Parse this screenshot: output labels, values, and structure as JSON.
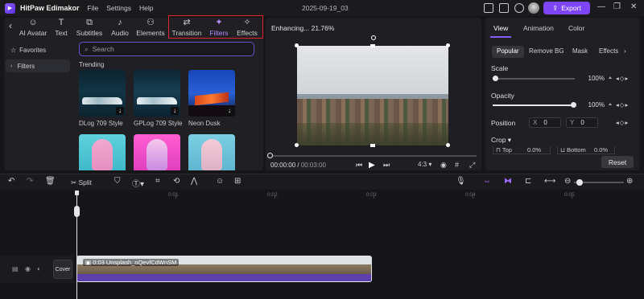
{
  "titlebar": {
    "app_name": "HitPaw Edimakor",
    "menus": [
      "File",
      "Settings",
      "Help"
    ],
    "doc_title": "2025-09-19_03",
    "export_label": "Export"
  },
  "toolbar": {
    "tools": [
      {
        "label": "AI Avatar",
        "icon": "avatar-icon"
      },
      {
        "label": "Text",
        "icon": "text-icon"
      },
      {
        "label": "Subtitles",
        "icon": "subtitles-icon"
      },
      {
        "label": "Audio",
        "icon": "music-icon"
      },
      {
        "label": "Elements",
        "icon": "elements-icon"
      },
      {
        "label": "Transition",
        "icon": "transition-icon"
      },
      {
        "label": "Filters",
        "icon": "sparkle-icon"
      },
      {
        "label": "Effects",
        "icon": "effects-icon"
      }
    ],
    "active_tool": "Filters"
  },
  "sidebar": {
    "items": [
      {
        "label": "Favorites"
      },
      {
        "label": "Filters"
      }
    ]
  },
  "search": {
    "placeholder": "Search"
  },
  "filters": {
    "section": "Trending",
    "row1": [
      {
        "label": "DLog 709 Style"
      },
      {
        "label": "GPLog 709 Style"
      },
      {
        "label": "Neon Dusk"
      }
    ]
  },
  "preview": {
    "status": "Enhancing... 21.76%",
    "current_time": "00:00:00",
    "total_time": "00:03:00",
    "aspect": "4:3"
  },
  "properties": {
    "tabs": [
      "View",
      "Animation",
      "Color"
    ],
    "active_tab": "View",
    "subtabs": [
      "Popular",
      "Remove BG",
      "Mask",
      "Effects"
    ],
    "active_subtab": "Popular",
    "scale": {
      "label": "Scale",
      "value": "100%",
      "level": 0.03
    },
    "opacity": {
      "label": "Opacity",
      "value": "100%",
      "level": 1.0
    },
    "position": {
      "label": "Position",
      "x_label": "X",
      "x": "0",
      "y_label": "Y",
      "y": "0"
    },
    "crop": {
      "label": "Crop",
      "top_label": "Top",
      "top": "0.0%",
      "bottom_label": "Bottom",
      "bottom": "0.0%"
    },
    "reset_label": "Reset"
  },
  "timeline": {
    "split_label": "Split",
    "ruler": [
      "0:01",
      "0:02",
      "0:03",
      "0:04",
      "0:05"
    ],
    "cover_label": "Cover",
    "clip_label": "0:03 Unsplash_nQevfCdWnSM"
  }
}
